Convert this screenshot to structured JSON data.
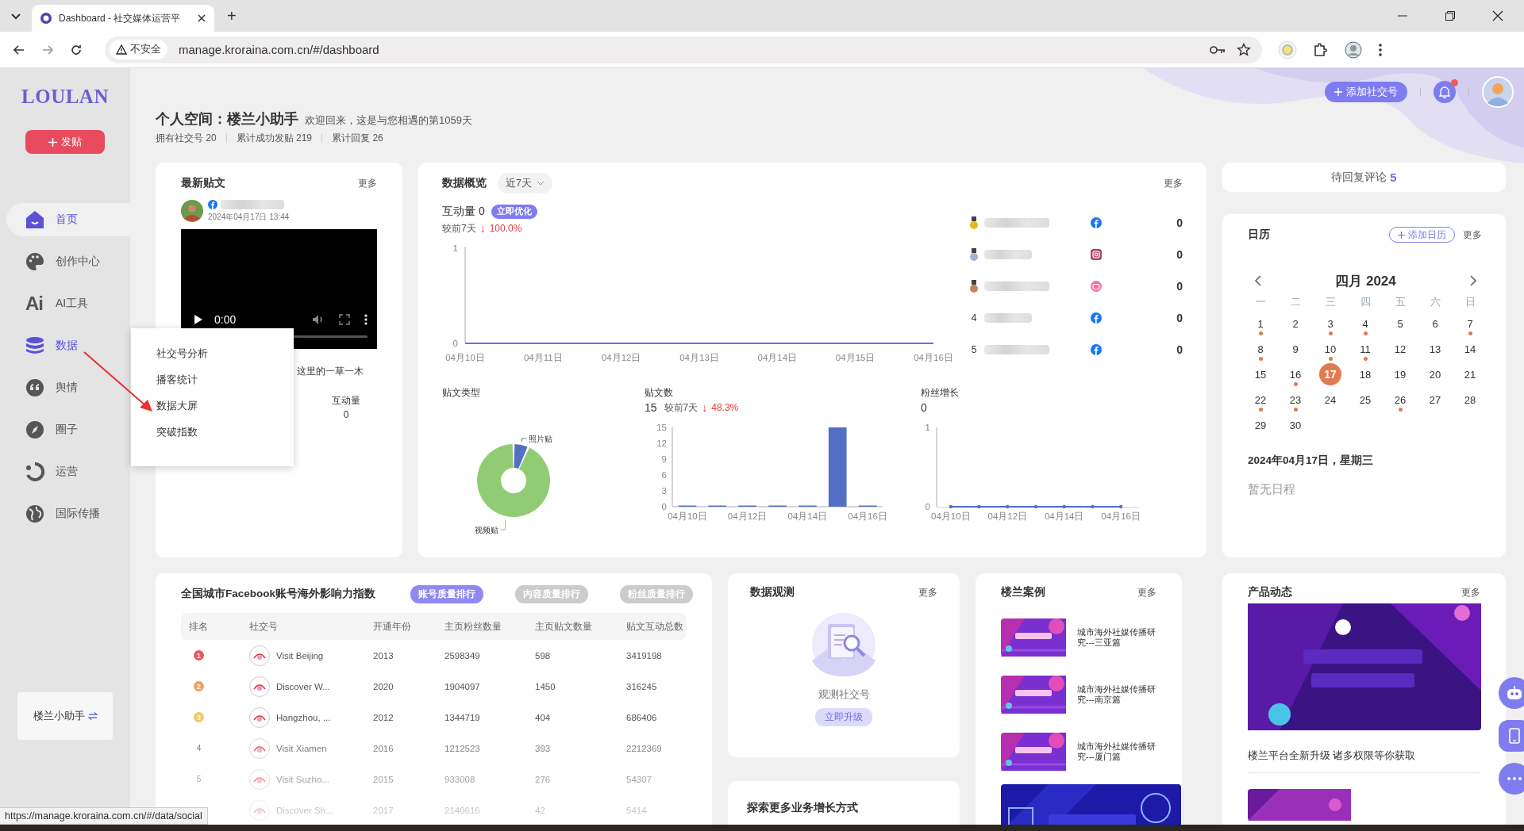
{
  "browser": {
    "tab_title": "Dashboard - 社交媒体运营平",
    "new_tab": "+",
    "security": "不安全",
    "url": "manage.kroraina.com.cn/#/dashboard"
  },
  "sidebar": {
    "logo": "LOULAN",
    "post_button": "发贴",
    "user": "楼兰小助手",
    "items": [
      {
        "label": "首页",
        "kind": "home",
        "selected": true,
        "expanded": false
      },
      {
        "label": "创作中心",
        "kind": "palette",
        "selected": false,
        "expanded": false
      },
      {
        "label": "AI工具",
        "kind": "ai",
        "glyph": "Ai",
        "selected": false,
        "expanded": false
      },
      {
        "label": "数据",
        "kind": "database",
        "selected": false,
        "expanded": true
      },
      {
        "label": "舆情",
        "kind": "quote",
        "selected": false,
        "expanded": false
      },
      {
        "label": "圈子",
        "kind": "compass",
        "selected": false,
        "expanded": false
      },
      {
        "label": "运营",
        "kind": "cycle",
        "selected": false,
        "expanded": false
      },
      {
        "label": "国际传播",
        "kind": "globe",
        "selected": false,
        "expanded": false
      }
    ]
  },
  "popup_menu": [
    "社交号分析",
    "播客统计",
    "数据大屏",
    "突破指数"
  ],
  "header": {
    "title": "个人空间：楼兰小助手",
    "welcome": "欢迎回来，这是与您相遇的第1059天",
    "stats": [
      "拥有社交号 20",
      "累计成功发贴 219",
      "累计回复 26"
    ],
    "add_account": "添加社交号",
    "notification": true
  },
  "latest_post": {
    "title": "最新贴文",
    "more": "更多",
    "time": "2024年04月17日 13:44",
    "video_time": "0:00",
    "text": "这里的一草一木",
    "stats": [
      {
        "label": "互动量",
        "value": "0"
      }
    ]
  },
  "data_overview": {
    "title": "数据概览",
    "range": "近7天",
    "more": "更多",
    "interaction": "互动量 0",
    "badge": "立即优化",
    "compare": "较前7天",
    "arrow": "↓",
    "change": "100.0%",
    "chart_data": {
      "type": "line",
      "categories": [
        "04月10日",
        "04月11日",
        "04月12日",
        "04月13日",
        "04月14日",
        "04月15日",
        "04月16日"
      ],
      "series": [
        {
          "color": "#6b6bf0",
          "values": [
            0,
            0,
            0,
            0,
            0,
            0,
            0
          ]
        }
      ],
      "ylim": [
        0,
        1
      ],
      "yticks": [
        0,
        1
      ]
    },
    "ranking": [
      {
        "color": "#f0b429",
        "kind": "facebook",
        "value": "0"
      },
      {
        "color": "#9bb7d4",
        "kind": "instagram",
        "value": "0"
      },
      {
        "color": "#c8815a",
        "kind": "other",
        "value": "0"
      },
      {
        "rank": "4",
        "kind": "facebook",
        "value": "0"
      },
      {
        "rank": "5",
        "kind": "facebook",
        "value": "0"
      }
    ],
    "post_type": {
      "title": "贴文类型",
      "chart_data": {
        "type": "donut",
        "categories": [
          "照片贴",
          "视频贴"
        ],
        "values": [
          6.7,
          93.3
        ],
        "colors": [
          "#5470c6",
          "#91cc75"
        ]
      }
    },
    "post_count": {
      "title": "贴文数",
      "value": "15",
      "compare": "较前7天",
      "arrow": "↓",
      "change": "48.3%",
      "chart_data": {
        "type": "bar",
        "categories": [
          "04月10日",
          null,
          "04月12日",
          null,
          "04月14日",
          null,
          "04月16日"
        ],
        "values": [
          0,
          0,
          0,
          0,
          0,
          15,
          0
        ],
        "color": "#5470c6",
        "ylim": [
          0,
          15
        ],
        "yticks": [
          0,
          3,
          6,
          9,
          12,
          15
        ]
      }
    },
    "fans": {
      "title": "粉丝增长",
      "value": "0",
      "chart_data": {
        "type": "line",
        "categories": [
          "04月10日",
          null,
          "04月12日",
          null,
          "04月14日",
          null,
          "04月16日"
        ],
        "series": [
          {
            "color": "#5470c6",
            "values": [
              0,
              0,
              0,
              0,
              0,
              0,
              0
            ]
          }
        ],
        "ylim": [
          0,
          1
        ],
        "yticks": [
          0,
          1
        ]
      }
    }
  },
  "pending": {
    "label": "待回复评论",
    "count": "5"
  },
  "calendar": {
    "title": "日历",
    "add": "添加日历",
    "more": "更多",
    "month": "四月 2024",
    "weekdays": [
      "一",
      "二",
      "三",
      "四",
      "五",
      "六",
      "日"
    ],
    "days": [
      {
        "day": "1",
        "event": true,
        "selected": false
      },
      {
        "day": "2",
        "event": false,
        "selected": false
      },
      {
        "day": "3",
        "event": true,
        "selected": false
      },
      {
        "day": "4",
        "event": true,
        "selected": false
      },
      {
        "day": "5",
        "event": false,
        "selected": false
      },
      {
        "day": "6",
        "event": false,
        "selected": false
      },
      {
        "day": "7",
        "event": true,
        "selected": false
      },
      {
        "day": "8",
        "event": true,
        "selected": false
      },
      {
        "day": "9",
        "event": false,
        "selected": false
      },
      {
        "day": "10",
        "event": true,
        "selected": false
      },
      {
        "day": "11",
        "event": true,
        "selected": false
      },
      {
        "day": "12",
        "event": false,
        "selected": false
      },
      {
        "day": "13",
        "event": false,
        "selected": false
      },
      {
        "day": "14",
        "event": false,
        "selected": false
      },
      {
        "day": "15",
        "event": false,
        "selected": false
      },
      {
        "day": "16",
        "event": true,
        "selected": false
      },
      {
        "day": "17",
        "event": false,
        "selected": true
      },
      {
        "day": "18",
        "event": false,
        "selected": false
      },
      {
        "day": "19",
        "event": false,
        "selected": false
      },
      {
        "day": "20",
        "event": false,
        "selected": false
      },
      {
        "day": "21",
        "event": false,
        "selected": false
      },
      {
        "day": "22",
        "event": true,
        "selected": false
      },
      {
        "day": "23",
        "event": true,
        "selected": false
      },
      {
        "day": "24",
        "event": false,
        "selected": false
      },
      {
        "day": "25",
        "event": false,
        "selected": false
      },
      {
        "day": "26",
        "event": true,
        "selected": false
      },
      {
        "day": "27",
        "event": false,
        "selected": false
      },
      {
        "day": "28",
        "event": false,
        "selected": false
      },
      {
        "day": "29",
        "event": false,
        "selected": false
      },
      {
        "day": "30",
        "event": false,
        "selected": false
      }
    ],
    "date_label": "2024年04月17日，星期三",
    "empty": "暂无日程"
  },
  "ranking_table": {
    "title": "全国城市Facebook账号海外影响力指数",
    "tabs": [
      {
        "label": "账号质量排行",
        "selected": true
      },
      {
        "label": "内容质量排行",
        "selected": false
      },
      {
        "label": "粉丝质量排行",
        "selected": false
      }
    ],
    "columns": [
      "排名",
      "社交号",
      "开通年份",
      "主页粉丝数量",
      "主页贴文数量",
      "贴文互动总数"
    ],
    "rows": [
      {
        "rank": "1",
        "color": "#e85a5a",
        "account": "Visit Beijing",
        "year": "2013",
        "fans": "2598349",
        "posts": "598",
        "interactions": "3419198"
      },
      {
        "rank": "2",
        "color": "#f0a060",
        "account": "Discover W...",
        "year": "2020",
        "fans": "1904097",
        "posts": "1450",
        "interactions": "316245"
      },
      {
        "rank": "3",
        "color": "#f2c76a",
        "account": "Hangzhou, ...",
        "year": "2012",
        "fans": "1344719",
        "posts": "404",
        "interactions": "686406"
      },
      {
        "rank": "4",
        "account": "Visit Xiamen",
        "year": "2016",
        "fans": "1212523",
        "posts": "393",
        "interactions": "2212369"
      },
      {
        "rank": "5",
        "account": "Visit Suzho...",
        "year": "2015",
        "fans": "933008",
        "posts": "276",
        "interactions": "54307"
      },
      {
        "account": "Discover Sh...",
        "year": "2017",
        "fans": "2140616",
        "posts": "42",
        "interactions": "5414"
      }
    ]
  },
  "observation": {
    "title": "数据观测",
    "more": "更多",
    "label": "观测社交号",
    "button": "立即升级"
  },
  "explore": {
    "title": "探索更多业务增长方式"
  },
  "cases": {
    "title": "楼兰案例",
    "more": "更多",
    "items": [
      "城市海外社媒传播研究---三亚篇",
      "城市海外社媒传播研究---南京篇",
      "城市海外社媒传播研究---厦门篇"
    ]
  },
  "product": {
    "title": "产品动态",
    "more": "更多",
    "caption": "楼兰平台全新升级 诸多权限等你获取"
  },
  "status_url": "https://manage.kroraina.com.cn/#/data/social"
}
